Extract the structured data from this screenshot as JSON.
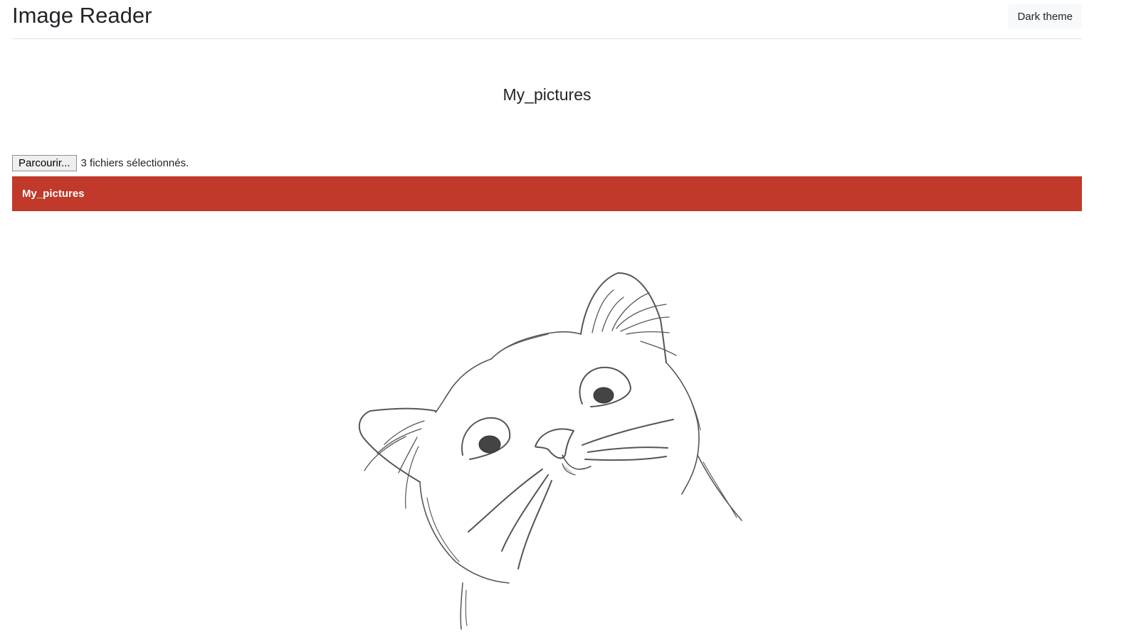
{
  "header": {
    "title": "Image Reader",
    "theme_button_label": "Dark theme"
  },
  "main": {
    "folder_title": "My_pictures",
    "file_input": {
      "browse_label": "Parcourir...",
      "status": "3 fichiers sélectionnés."
    },
    "folder_bar": {
      "label": "My_pictures",
      "color": "#c0392b"
    },
    "image": {
      "subject": "cat-sketch"
    }
  }
}
